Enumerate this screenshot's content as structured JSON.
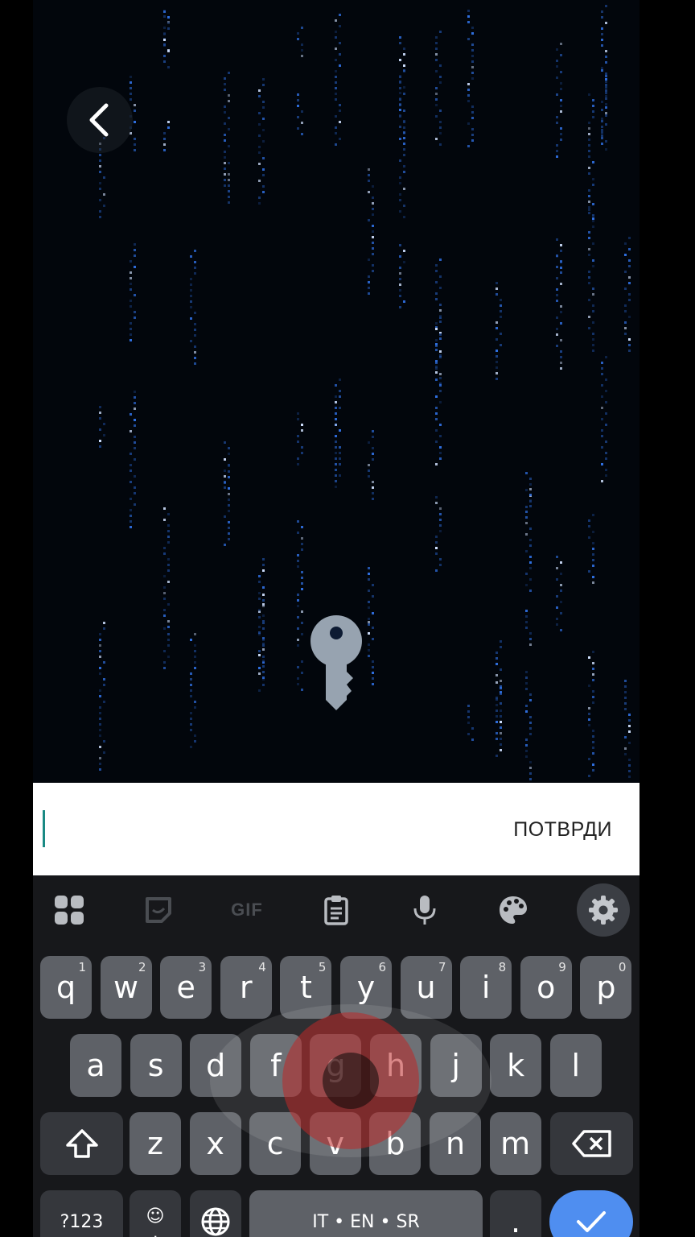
{
  "header": {
    "back_icon": "chevron-left-icon"
  },
  "center_icon": "key-icon",
  "input": {
    "value": "",
    "confirm_label": "ПОТВРДИ"
  },
  "keyboard_toolbar": [
    {
      "name": "apps-grid-icon"
    },
    {
      "name": "sticker-icon"
    },
    {
      "name": "gif-button",
      "label": "GIF"
    },
    {
      "name": "clipboard-icon"
    },
    {
      "name": "mic-icon"
    },
    {
      "name": "palette-icon"
    },
    {
      "name": "gear-icon"
    }
  ],
  "keyboard": {
    "row1": [
      {
        "key": "q",
        "hint": "1"
      },
      {
        "key": "w",
        "hint": "2"
      },
      {
        "key": "e",
        "hint": "3"
      },
      {
        "key": "r",
        "hint": "4"
      },
      {
        "key": "t",
        "hint": "5"
      },
      {
        "key": "y",
        "hint": "6"
      },
      {
        "key": "u",
        "hint": "7"
      },
      {
        "key": "i",
        "hint": "8"
      },
      {
        "key": "o",
        "hint": "9"
      },
      {
        "key": "p",
        "hint": "0"
      }
    ],
    "row2": [
      "a",
      "s",
      "d",
      "f",
      "g",
      "h",
      "j",
      "k",
      "l"
    ],
    "row3": [
      "z",
      "x",
      "c",
      "v",
      "b",
      "n",
      "m"
    ],
    "symbols_label": "?123",
    "emoji_label": "☺",
    "comma_label": ",",
    "space_label": "IT • EN • SR",
    "period_label": ".",
    "colors": {
      "key_bg": "#5e6167",
      "fn_bg": "#35373c",
      "enter_bg": "#4f8ef0",
      "accent_caret": "#1a8a84"
    }
  }
}
